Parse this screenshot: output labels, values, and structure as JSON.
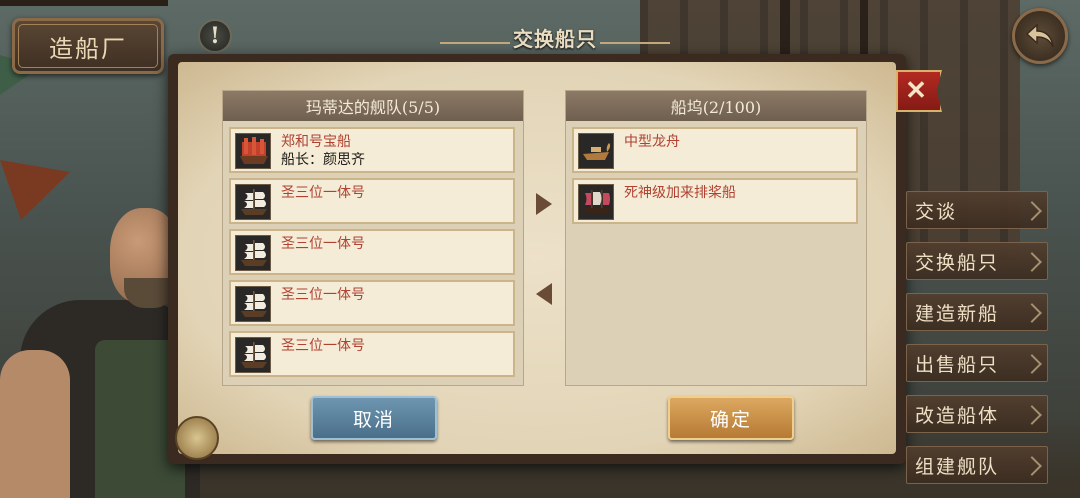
{
  "header": {
    "location_title": "造船厂",
    "dialog_title": "交换船只",
    "info_glyph": "!",
    "close_glyph": "✕"
  },
  "fleet_panel": {
    "title": "玛蒂达的舰队(5/5)",
    "ships": [
      {
        "name": "郑和号宝船",
        "captain": "船长：颜思齐",
        "icon": "treasure-ship-icon"
      },
      {
        "name": "圣三位一体号",
        "captain": "",
        "icon": "galleon-icon"
      },
      {
        "name": "圣三位一体号",
        "captain": "",
        "icon": "galleon-icon"
      },
      {
        "name": "圣三位一体号",
        "captain": "",
        "icon": "galleon-icon"
      },
      {
        "name": "圣三位一体号",
        "captain": "",
        "icon": "galleon-icon"
      }
    ]
  },
  "dock_panel": {
    "title": "船坞(2/100)",
    "ships": [
      {
        "name": "中型龙舟",
        "icon": "dragon-boat-icon"
      },
      {
        "name": "死神级加来排桨船",
        "icon": "galley-icon"
      }
    ]
  },
  "buttons": {
    "cancel": "取消",
    "confirm": "确定"
  },
  "side_menu": {
    "items": [
      "交谈",
      "交换船只",
      "建造新船",
      "出售船只",
      "改造船体",
      "组建舰队"
    ]
  },
  "colors": {
    "ship_name": "#b04232",
    "cancel_button": "#5a82a0",
    "confirm_button": "#c88f48",
    "close_button": "#a0231c"
  }
}
